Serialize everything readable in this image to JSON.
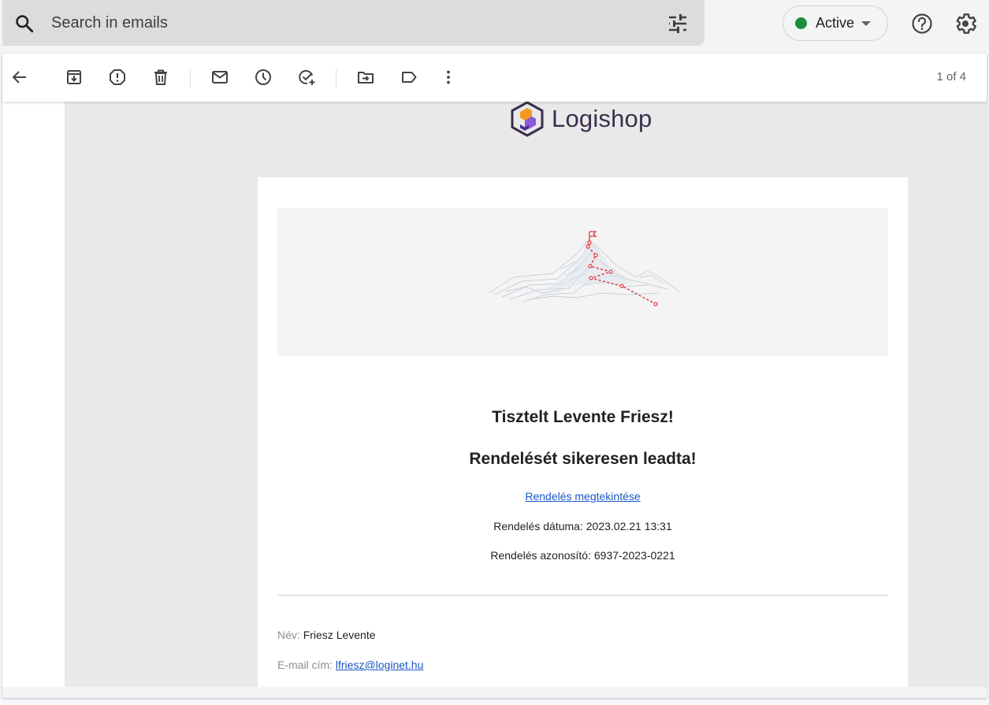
{
  "search": {
    "placeholder": "Search in emails",
    "icon": "search-icon",
    "options_icon": "tune-icon"
  },
  "status": {
    "label": "Active",
    "color": "#1e8e3e"
  },
  "header_icons": [
    "help-icon",
    "settings-gear-icon"
  ],
  "toolbar": {
    "buttons": [
      {
        "name": "back",
        "icon": "arrow-back-icon"
      },
      {
        "name": "archive",
        "icon": "archive-icon"
      },
      {
        "name": "report-spam",
        "icon": "report-spam-icon"
      },
      {
        "name": "delete",
        "icon": "trash-icon"
      },
      {
        "name": "mark-unread",
        "icon": "mail-icon"
      },
      {
        "name": "snooze",
        "icon": "clock-icon"
      },
      {
        "name": "add-task",
        "icon": "add-task-icon"
      },
      {
        "name": "move-to",
        "icon": "move-to-folder-icon"
      },
      {
        "name": "labels",
        "icon": "label-icon"
      },
      {
        "name": "more",
        "icon": "more-vertical-icon"
      }
    ],
    "pager": "1 of 4"
  },
  "email": {
    "brand": {
      "name": "Logishop",
      "colors": {
        "orange": "#f39a1e",
        "purple": "#7b4fd0",
        "dark_purple": "#3b2f4e"
      }
    },
    "hero_image": "mountain-with-flag-path-illustration",
    "greeting": "Tisztelt Levente Friesz!",
    "headline": "Rendelését sikeresen leadta!",
    "view_order_link": "Rendelés megtekintése",
    "order_date_label": "Rendelés dátuma:",
    "order_date": "2023.02.21 13:31",
    "order_id_label": "Rendelés azonosító:",
    "order_id": "6937-2023-0221",
    "customer": {
      "name_label": "Név:",
      "name": "Friesz Levente",
      "email_label": "E-mail cím:",
      "email": "lfriesz@loginet.hu"
    }
  }
}
